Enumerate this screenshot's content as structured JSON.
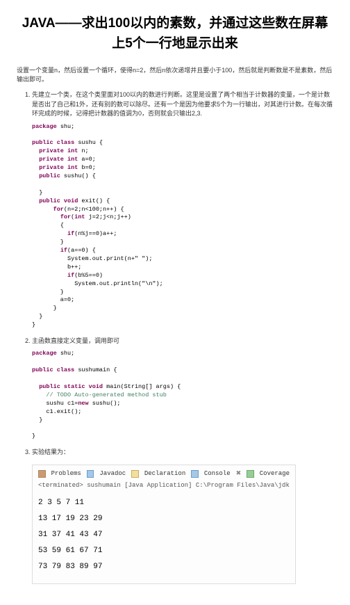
{
  "title": "JAVA——求出100以内的素数，并通过这些数在屏幕上5个一行地显示出来",
  "intro": "设置一个变量n，然后设置一个循环，使得n=2，然后n依次递增并且要小于100，然后就是判断数是不是素数，然后输出即可。",
  "steps": {
    "s1": "先建立一个类，在这个类里面对100以内的数进行判断。这里是设置了两个相当于计数器的变量，一个是计数是否出了自己和1外，还有别的数可以除尽。还有一个是因为他要求5个为一行输出，对其进行计数。在每次循环完成的时候，记得把计数器的值调为0，否则就会只输出2,3.",
    "s2": "主函数直接定义变量，调用即可",
    "s3": "实验结果为："
  },
  "code1": {
    "pkg": "package",
    "pkgname": " shu;",
    "pc": "public class",
    "cls": " sushu {",
    "pi": "  private int",
    "n": " n;",
    "a": " a=0;",
    "b": " b=0;",
    "pub": "  public",
    "ctor": " sushu() {",
    "cb": "  }",
    "pv": "  public void",
    "exit": " exit() {",
    "for1a": "for",
    "for1b": "(n=2;n<100;n++) {",
    "for2a": "for",
    "for2b": "(",
    "intkw": "int",
    "for2c": " j=2;j<n;j++)",
    "lb": "        {",
    "if1a": "if",
    "if1b": "(n%j==0)a++;",
    "rb": "        }",
    "if2a": "if",
    "if2b": "(a==0) {",
    "p1": "          System.out.print(n+\" \");",
    "bpp": "          b++;",
    "if3a": "if",
    "if3b": "(b%5==0)",
    "p2": "            System.out.println(\"\\n\");",
    "rb2": "        }",
    "a0": "        a=0;",
    "rb3": "      }",
    "rb4": "  }",
    "rb5": "}"
  },
  "code2": {
    "pkg": "package",
    "pkgname": " shu;",
    "pc": "public class",
    "cls": " sushumain {",
    "psvm1": "  public static void",
    "psvm2": " main(String[] args) {",
    "todo": "    // TODO Auto-generated method stub",
    "new1": "    sushu c1=",
    "newkw": "new",
    "new2": " sushu();",
    "call": "    c1.exit();",
    "rb1": "  }",
    "rb2": "}"
  },
  "output": {
    "tabs": {
      "t1": "Problems",
      "t2": "Javadoc",
      "t3": "Declaration",
      "t4": "Console",
      "t5": "Coverage"
    },
    "term": "<terminated> sushumain [Java Application] C:\\Program Files\\Java\\jdk",
    "rows": [
      "2 3 5 7 11",
      "13 17 19 23 29",
      "31 37 41 43 47",
      "53 59 61 67 71",
      "73 79 83 89 97"
    ]
  }
}
